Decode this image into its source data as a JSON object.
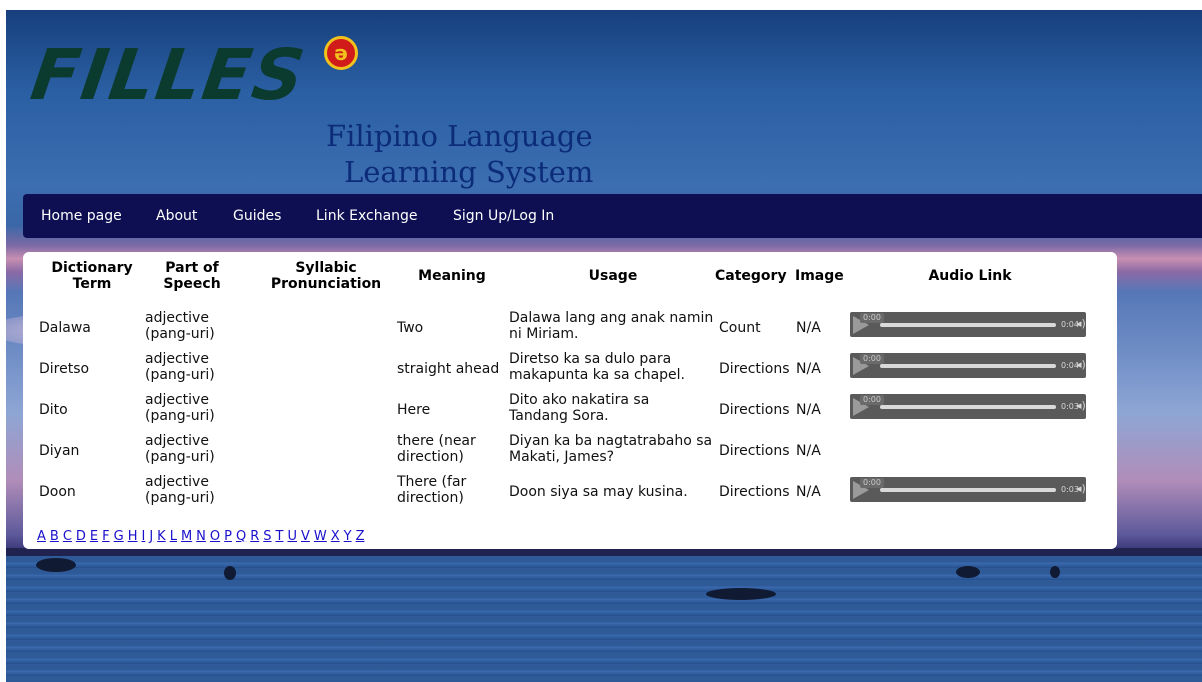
{
  "header": {
    "logo_text": "FILLES",
    "logo_badge": "ə",
    "subtitle_line1": "Filipino Language",
    "subtitle_line2": "Learning System"
  },
  "nav": {
    "items": [
      "Home page",
      "About",
      "Guides",
      "Link Exchange",
      "Sign Up/Log In"
    ]
  },
  "table": {
    "headers": {
      "term": [
        "Dictionary",
        "Term"
      ],
      "pos": [
        "Part of",
        "Speech"
      ],
      "syllabic": [
        "Syllabic",
        "Pronunciation"
      ],
      "meaning": "Meaning",
      "usage": "Usage",
      "category": "Category",
      "image": "Image",
      "audio": "Audio Link"
    },
    "rows": [
      {
        "term": "Dalawa",
        "pos": [
          "adjective",
          "(pang-uri)"
        ],
        "meaning": [
          "Two"
        ],
        "usage": [
          "Dalawa lang ang anak namin",
          "ni Miriam."
        ],
        "category": "Count",
        "image": "N/A",
        "audio": {
          "current": "0:00",
          "duration": "0:04"
        }
      },
      {
        "term": "Diretso",
        "pos": [
          "adjective",
          "(pang-uri)"
        ],
        "meaning": [
          "straight ahead"
        ],
        "usage": [
          "Diretso ka sa dulo para",
          "makapunta ka sa chapel."
        ],
        "category": "Directions",
        "image": "N/A",
        "audio": {
          "current": "0:00",
          "duration": "0:04"
        }
      },
      {
        "term": "Dito",
        "pos": [
          "adjective",
          "(pang-uri)"
        ],
        "meaning": [
          "Here"
        ],
        "usage": [
          "Dito ako nakatira sa",
          "Tandang Sora."
        ],
        "category": "Directions",
        "image": "N/A",
        "audio": {
          "current": "0:00",
          "duration": "0:03"
        }
      },
      {
        "term": "Diyan",
        "pos": [
          "adjective",
          "(pang-uri)"
        ],
        "meaning": [
          "there (near",
          "direction)"
        ],
        "usage": [
          "Diyan ka ba nagtatrabaho sa",
          "Makati, James?"
        ],
        "category": "Directions",
        "image": "N/A",
        "audio": null
      },
      {
        "term": "Doon",
        "pos": [
          "adjective",
          "(pang-uri)"
        ],
        "meaning": [
          "There (far",
          "direction)"
        ],
        "usage": [
          "Doon siya sa may kusina."
        ],
        "category": "Directions",
        "image": "N/A",
        "audio": {
          "current": "0:00",
          "duration": "0:03"
        }
      }
    ]
  },
  "alphabet": [
    "A",
    "B",
    "C",
    "D",
    "E",
    "F",
    "G",
    "H",
    "I",
    "J",
    "K",
    "L",
    "M",
    "N",
    "O",
    "P",
    "Q",
    "R",
    "S",
    "T",
    "U",
    "V",
    "W",
    "X",
    "Y",
    "Z"
  ],
  "colors": {
    "nav_bg": "#0d0f52",
    "logo": "#0b3a2e",
    "subtitle": "#0c2c7a",
    "link": "#1a10cc"
  }
}
